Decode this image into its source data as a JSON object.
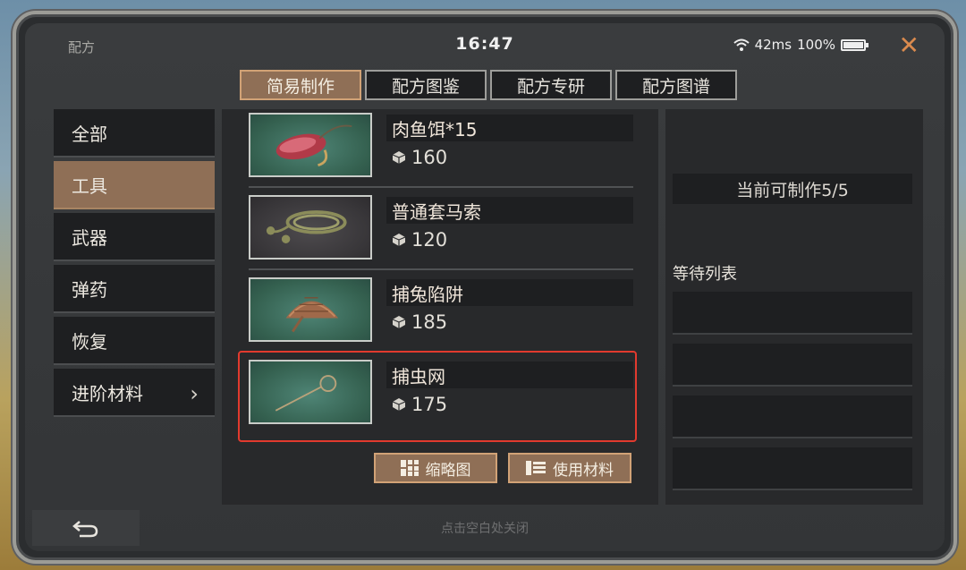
{
  "status": {
    "title": "配方",
    "time": "16:47",
    "ping": "42ms",
    "battery": "100%"
  },
  "tabs": [
    {
      "label": "简易制作",
      "active": true
    },
    {
      "label": "配方图鉴",
      "active": false
    },
    {
      "label": "配方专研",
      "active": false
    },
    {
      "label": "配方图谱",
      "active": false
    }
  ],
  "sidebar": {
    "items": [
      {
        "label": "全部"
      },
      {
        "label": "工具"
      },
      {
        "label": "武器"
      },
      {
        "label": "弹药"
      },
      {
        "label": "恢复"
      },
      {
        "label": "进阶材料"
      }
    ]
  },
  "recipes": [
    {
      "name": "肉鱼饵*15",
      "cost": "160",
      "icon": "meat-bait-icon"
    },
    {
      "name": "普通套马索",
      "cost": "120",
      "icon": "lasso-icon"
    },
    {
      "name": "捕兔陷阱",
      "cost": "185",
      "icon": "rabbit-trap-icon"
    },
    {
      "name": "捕虫网",
      "cost": "175",
      "icon": "bug-net-icon"
    }
  ],
  "buttons": {
    "thumbnail": "缩略图",
    "use_material": "使用材料"
  },
  "right_panel": {
    "can_make": "当前可制作5/5",
    "waiting_list": "等待列表"
  },
  "footer": {
    "tap_close": "点击空白处关闭"
  },
  "colors": {
    "accent": "#8f6f56",
    "highlight": "#e23a2e",
    "close": "#d98a4e"
  }
}
